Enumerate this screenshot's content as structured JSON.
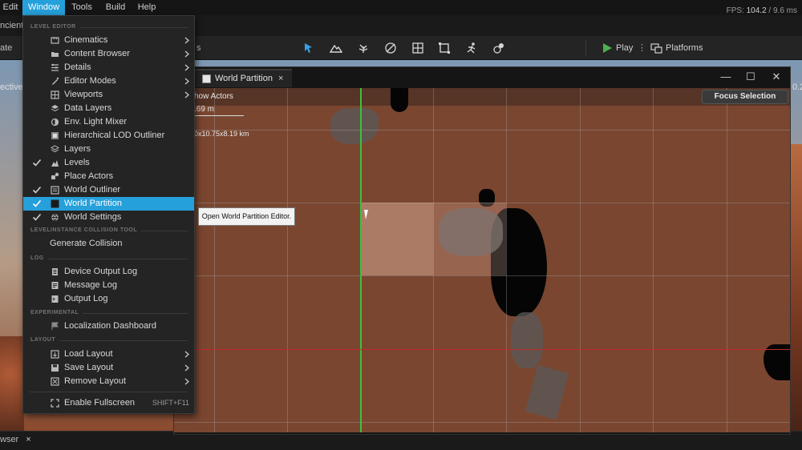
{
  "menubar": {
    "items": [
      "Edit",
      "Window",
      "Tools",
      "Build",
      "Help"
    ],
    "active": "Window",
    "fps_label": "FPS:",
    "fps_value": "104.2",
    "frame_time": "/ 9.6 ms"
  },
  "tabs": {
    "level_tab_cut": "ncient\\"
  },
  "toolbar": {
    "left_cut": "ate",
    "modes_cut": "s",
    "play_label": "Play",
    "platforms_label": "Platforms"
  },
  "viewport": {
    "left_label": "ective",
    "right_label": "0.2"
  },
  "bottom": {
    "tab_label": "wser",
    "tab_close": "×"
  },
  "world_partition_window": {
    "tab_label": "World Partition",
    "tab_close": "×",
    "minimize": "—",
    "maximize": "☐",
    "close": "✕",
    "show_actors": "how Actors",
    "scale_label": ".69 m",
    "world_size": "0x10.75x8.19 km",
    "focus_button": "Focus Selection"
  },
  "window_menu": {
    "sections": [
      {
        "header": "LEVEL EDITOR",
        "items": [
          {
            "label": "Cinematics",
            "icon": "cinematics-icon",
            "submenu": true,
            "checked": false
          },
          {
            "label": "Content Browser",
            "icon": "content-browser-icon",
            "submenu": true,
            "checked": false
          },
          {
            "label": "Details",
            "icon": "details-icon",
            "submenu": true,
            "checked": false
          },
          {
            "label": "Editor Modes",
            "icon": "editor-modes-icon",
            "submenu": true,
            "checked": false
          },
          {
            "label": "Viewports",
            "icon": "viewports-icon",
            "submenu": true,
            "checked": false
          },
          {
            "label": "Data Layers",
            "icon": "data-layers-icon",
            "submenu": false,
            "checked": false
          },
          {
            "label": "Env. Light Mixer",
            "icon": "light-mixer-icon",
            "submenu": false,
            "checked": false
          },
          {
            "label": "Hierarchical LOD Outliner",
            "icon": "hlod-outliner-icon",
            "submenu": false,
            "checked": false
          },
          {
            "label": "Layers",
            "icon": "layers-icon",
            "submenu": false,
            "checked": false
          },
          {
            "label": "Levels",
            "icon": "levels-icon",
            "submenu": false,
            "checked": true
          },
          {
            "label": "Place Actors",
            "icon": "place-actors-icon",
            "submenu": false,
            "checked": false
          },
          {
            "label": "World Outliner",
            "icon": "world-outliner-icon",
            "submenu": false,
            "checked": true
          },
          {
            "label": "World Partition",
            "icon": "world-partition-icon",
            "submenu": false,
            "checked": true,
            "selected": true
          },
          {
            "label": "World Settings",
            "icon": "world-settings-icon",
            "submenu": false,
            "checked": true
          }
        ]
      },
      {
        "header": "LEVELINSTANCE COLLISION TOOL",
        "items": [
          {
            "label": "Generate Collision",
            "icon": "",
            "submenu": false,
            "checked": false
          }
        ]
      },
      {
        "header": "LOG",
        "items": [
          {
            "label": "Device Output Log",
            "icon": "device-log-icon",
            "submenu": false,
            "checked": false
          },
          {
            "label": "Message Log",
            "icon": "message-log-icon",
            "submenu": false,
            "checked": false
          },
          {
            "label": "Output Log",
            "icon": "output-log-icon",
            "submenu": false,
            "checked": false
          }
        ]
      },
      {
        "header": "EXPERIMENTAL",
        "items": [
          {
            "label": "Localization Dashboard",
            "icon": "localization-flag-icon",
            "submenu": false,
            "checked": false
          }
        ]
      },
      {
        "header": "LAYOUT",
        "items": [
          {
            "label": "Load Layout",
            "icon": "load-layout-icon",
            "submenu": true,
            "checked": false
          },
          {
            "label": "Save Layout",
            "icon": "save-layout-icon",
            "submenu": true,
            "checked": false
          },
          {
            "label": "Remove Layout",
            "icon": "remove-layout-icon",
            "submenu": true,
            "checked": false
          }
        ]
      },
      {
        "header": "",
        "items": [
          {
            "label": "Enable Fullscreen",
            "icon": "fullscreen-icon",
            "submenu": false,
            "checked": false,
            "shortcut": "SHIFT+F11"
          }
        ]
      }
    ]
  },
  "tooltip": {
    "text": "Open World Partition Editor."
  },
  "colors": {
    "accent": "#26a0da",
    "play_green": "#4caf50",
    "axis_green": "#3fbf3f",
    "axis_red": "#c02a2a"
  }
}
